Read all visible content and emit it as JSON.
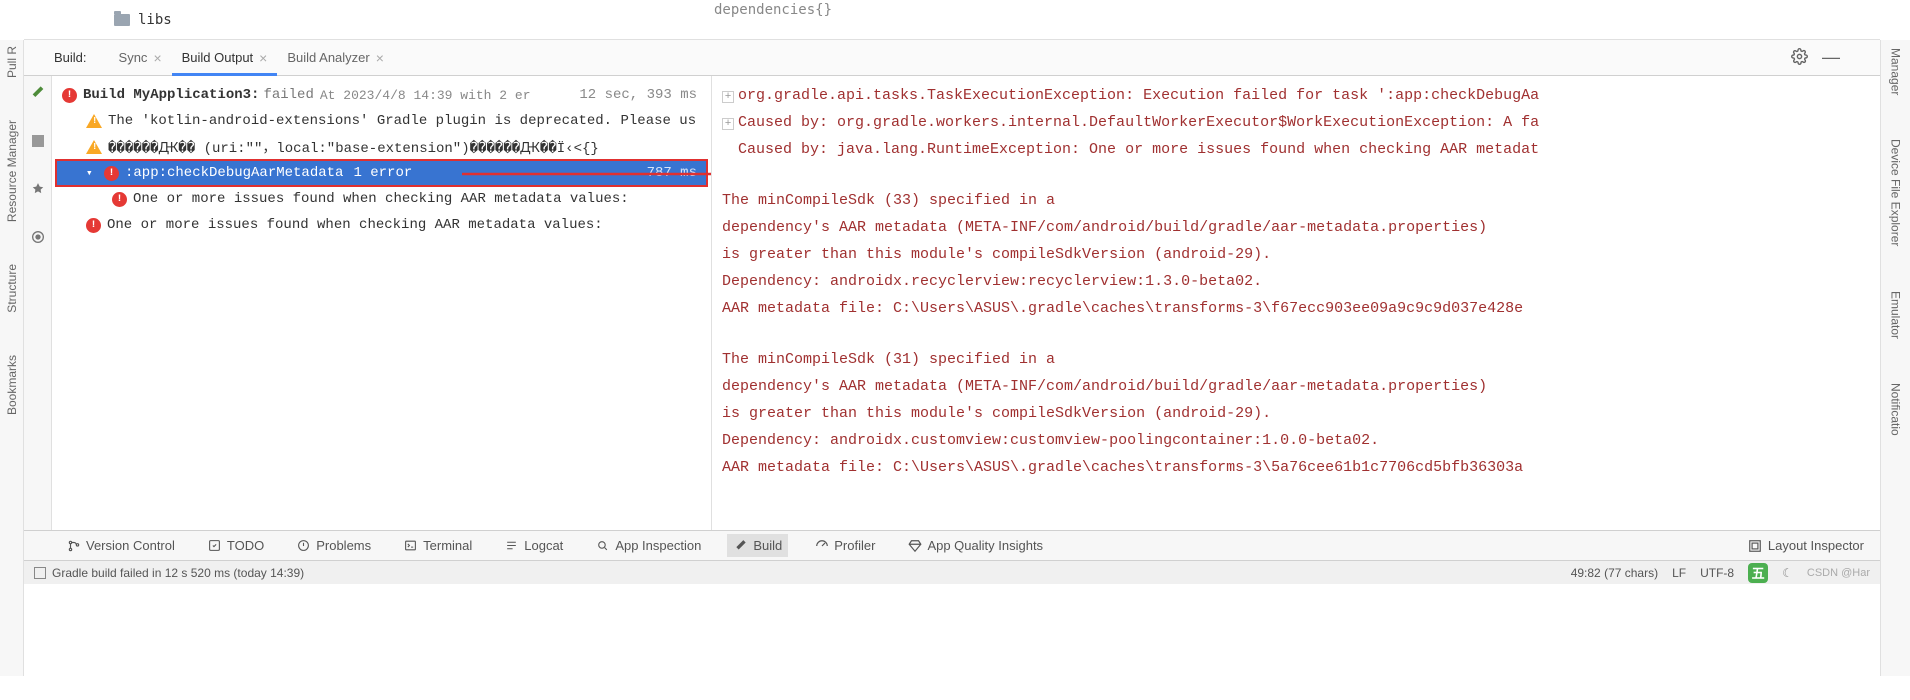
{
  "top": {
    "libs": "libs",
    "deps": "dependencies{}"
  },
  "build_tabs": {
    "label": "Build:",
    "sync": "Sync",
    "output": "Build Output",
    "analyzer": "Build Analyzer"
  },
  "tree": {
    "title_prefix": "Build MyApplication3:",
    "title_status": "failed",
    "title_time": "At 2023/4/8 14:39 with 2 er",
    "title_duration": "12 sec, 393 ms",
    "warn1": "The 'kotlin-android-extensions' Gradle plugin is deprecated. Please us",
    "warn2": "������Ԫ�� (uri:\"\"，local:\"base-extension\")������Ԫ��Ï‹<{}",
    "selected_task": ":app:checkDebugAarMetadata",
    "selected_errors": "1 error",
    "selected_time": "787 ms",
    "child1": "One or more issues found when checking AAR metadata values:",
    "child2": "One or more issues found when checking AAR metadata values:"
  },
  "details": {
    "l1": "org.gradle.api.tasks.TaskExecutionException: Execution failed for task ':app:checkDebugAa",
    "l2": "Caused by: org.gradle.workers.internal.DefaultWorkerExecutor$WorkExecutionException: A fa",
    "l3": "Caused by: java.lang.RuntimeException: One or more issues found when checking AAR metadat",
    "l4": "The minCompileSdk (33) specified in a",
    "l5": "dependency's AAR metadata (META-INF/com/android/build/gradle/aar-metadata.properties)",
    "l6": "is greater than this module's compileSdkVersion (android-29).",
    "l7": "Dependency: androidx.recyclerview:recyclerview:1.3.0-beta02.",
    "l8": "AAR metadata file: C:\\Users\\ASUS\\.gradle\\caches\\transforms-3\\f67ecc903ee09a9c9c9d037e428e",
    "l9": "The minCompileSdk (31) specified in a",
    "l10": "dependency's AAR metadata (META-INF/com/android/build/gradle/aar-metadata.properties)",
    "l11": "is greater than this module's compileSdkVersion (android-29).",
    "l12": "Dependency: androidx.customview:customview-poolingcontainer:1.0.0-beta02.",
    "l13": "AAR metadata file: C:\\Users\\ASUS\\.gradle\\caches\\transforms-3\\5a76cee61b1c7706cd5bfb36303a"
  },
  "bottom": {
    "vc": "Version Control",
    "todo": "TODO",
    "problems": "Problems",
    "terminal": "Terminal",
    "logcat": "Logcat",
    "inspection": "App Inspection",
    "build": "Build",
    "profiler": "Profiler",
    "quality": "App Quality Insights",
    "layout": "Layout Inspector"
  },
  "left_side": {
    "pull": "Pull R",
    "resource": "Resource Manager",
    "structure": "Structure",
    "bookmarks": "Bookmarks"
  },
  "right_side": {
    "manager": "Manager",
    "device": "Device File Explorer",
    "emulator": "Emulator",
    "notif": "Notificatio"
  },
  "status": {
    "left": "Gradle build failed in 12 s 520 ms (today 14:39)",
    "pos": "49:82 (77 chars)",
    "lf": "LF",
    "enc": "UTF-8",
    "ime": "五",
    "watermark": "CSDN @Har"
  }
}
